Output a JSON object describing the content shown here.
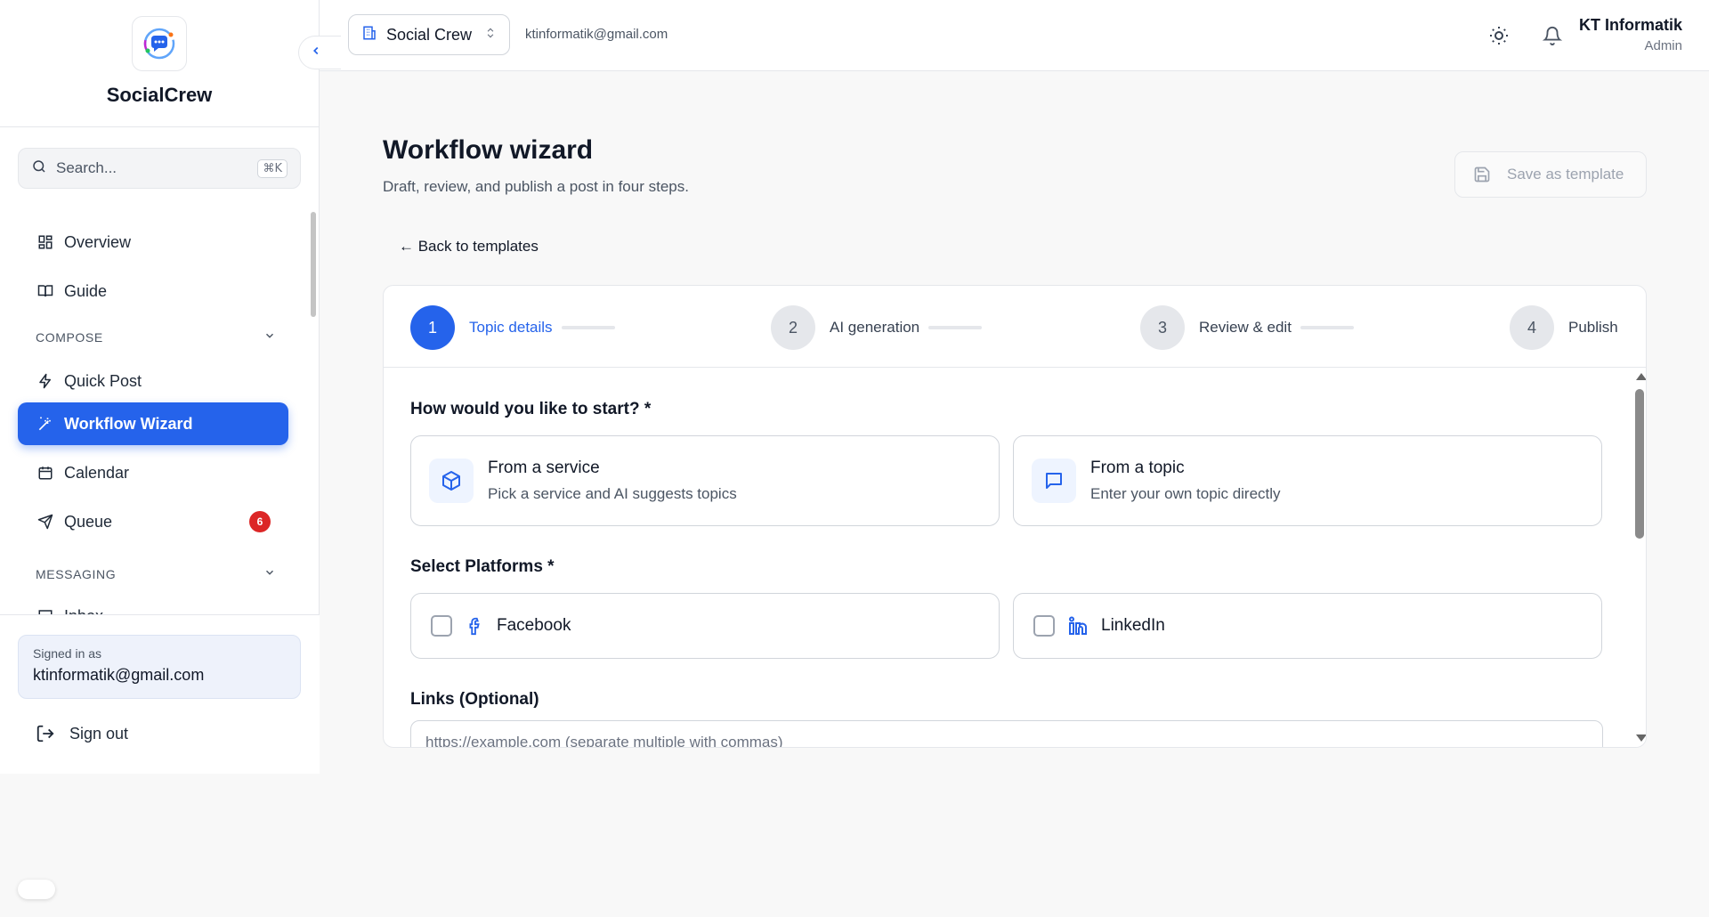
{
  "brand": {
    "name": "SocialCrew"
  },
  "search": {
    "placeholder": "Search...",
    "shortcut": "⌘K"
  },
  "nav": {
    "overview": "Overview",
    "guide": "Guide",
    "compose_section": "COMPOSE",
    "quick_post": "Quick Post",
    "workflow_wizard": "Workflow Wizard",
    "calendar": "Calendar",
    "queue": "Queue",
    "queue_badge": "6",
    "messaging_section": "MESSAGING",
    "inbox": "Inbox"
  },
  "account": {
    "signed_in_label": "Signed in as",
    "email": "ktinformatik@gmail.com",
    "sign_out": "Sign out"
  },
  "topbar": {
    "workspace": "Social Crew",
    "email": "ktinformatik@gmail.com",
    "user_name": "KT Informatik",
    "user_role": "Admin"
  },
  "page": {
    "title": "Workflow wizard",
    "subtitle": "Draft, review, and publish a post in four steps.",
    "save_template": "Save as template",
    "back_link": "← Back to templates"
  },
  "steps": [
    {
      "number": "1",
      "label": "Topic details",
      "active": true
    },
    {
      "number": "2",
      "label": "AI generation",
      "active": false
    },
    {
      "number": "3",
      "label": "Review & edit",
      "active": false
    },
    {
      "number": "4",
      "label": "Publish",
      "active": false
    }
  ],
  "form": {
    "start_question": "How would you like to start? *",
    "options": [
      {
        "title": "From a service",
        "desc": "Pick a service and AI suggests topics",
        "icon": "box-icon"
      },
      {
        "title": "From a topic",
        "desc": "Enter your own topic directly",
        "icon": "chat-icon"
      }
    ],
    "platforms_label": "Select Platforms *",
    "platforms": [
      {
        "name": "Facebook",
        "icon": "facebook-icon",
        "checked": false
      },
      {
        "name": "LinkedIn",
        "icon": "linkedin-icon",
        "checked": false
      }
    ],
    "links_label": "Links (Optional)",
    "links_placeholder": "https://example.com (separate multiple with commas)"
  },
  "colors": {
    "accent": "#2563eb",
    "badge": "#dc2626"
  }
}
